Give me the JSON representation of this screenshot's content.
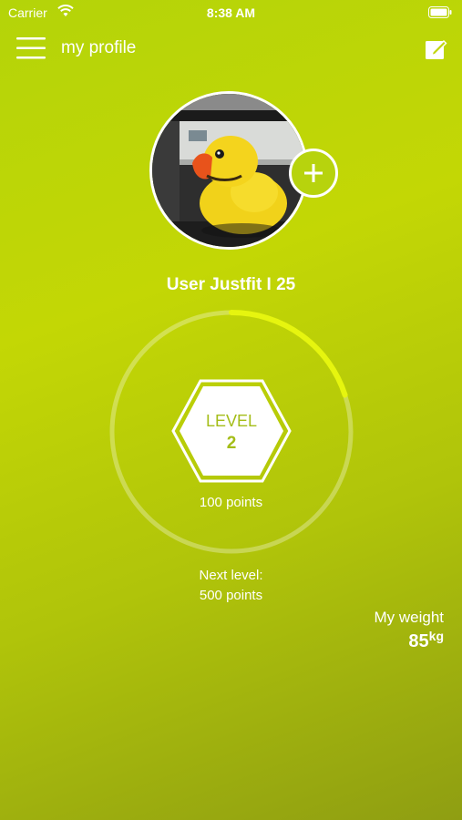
{
  "status_bar": {
    "carrier": "Carrier",
    "time": "8:38 AM"
  },
  "header": {
    "title": "my profile",
    "menu_icon": "hamburger-menu-icon",
    "edit_icon": "edit-note-icon"
  },
  "profile": {
    "name": "User Justfit I 25",
    "add_photo_icon": "plus-icon"
  },
  "level": {
    "label": "LEVEL",
    "number": "2",
    "points": "100  points",
    "progress_fraction": 0.2
  },
  "next_level": {
    "label": "Next level:",
    "points": "500  points"
  },
  "weight": {
    "label": "My weight",
    "value": "85",
    "unit": "kg"
  },
  "colors": {
    "accent": "#e6f50f",
    "hex_text": "#a4bd18",
    "background_top": "#b4d409",
    "background_bottom": "#8f9e12"
  }
}
